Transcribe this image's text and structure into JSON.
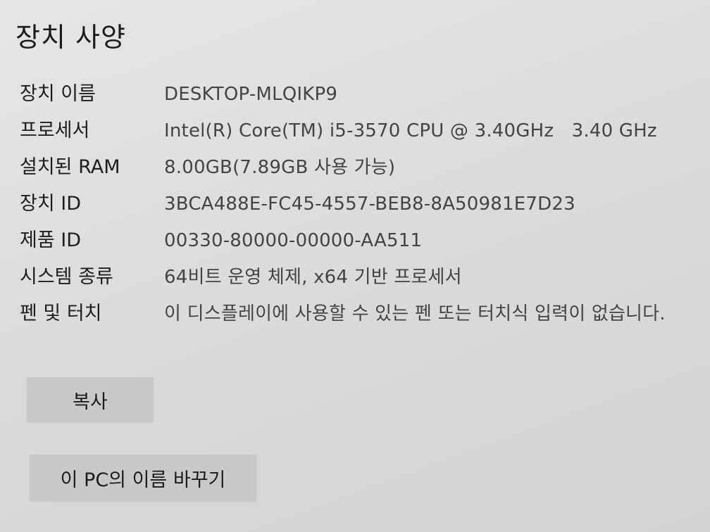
{
  "section": {
    "title": "장치 사양"
  },
  "specs": [
    {
      "label": "장치 이름",
      "value": "DESKTOP-MLQIKP9"
    },
    {
      "label": "프로세서",
      "value": "Intel(R) Core(TM) i5-3570 CPU @ 3.40GHz   3.40 GHz"
    },
    {
      "label": "설치된 RAM",
      "value": "8.00GB(7.89GB 사용 가능)"
    },
    {
      "label": "장치 ID",
      "value": "3BCA488E-FC45-4557-BEB8-8A50981E7D23"
    },
    {
      "label": "제품 ID",
      "value": "00330-80000-00000-AA511"
    },
    {
      "label": "시스템 종류",
      "value": "64비트 운영 체제, x64 기반 프로세서"
    },
    {
      "label": "펜 및 터치",
      "value": "이 디스플레이에 사용할 수 있는 펜 또는 터치식 입력이 없습니다."
    }
  ],
  "buttons": {
    "copy_label": "복사",
    "rename_label": "이 PC의 이름 바꾸기"
  }
}
